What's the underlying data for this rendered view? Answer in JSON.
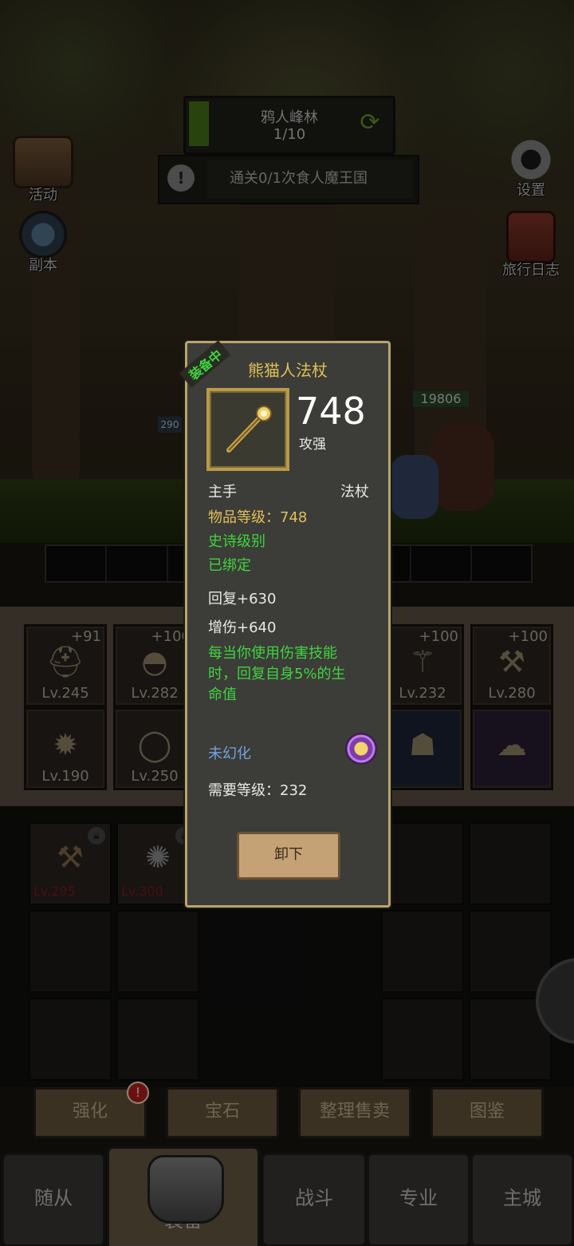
{
  "stage": {
    "title": "鸦人峰林",
    "progress": "1/10",
    "progress_fraction": 0.1
  },
  "quest": {
    "text": "通关0/1次食人魔王国"
  },
  "side": {
    "activity": "活动",
    "dungeon": "副本",
    "settings": "设置",
    "journal": "旅行日志"
  },
  "hero": {
    "health": "19806",
    "small_tag": "290"
  },
  "slots": [
    {
      "plus": "+91",
      "lv": "Lv.245",
      "icon": "helmet-icon"
    },
    {
      "plus": "+100",
      "lv": "Lv.282",
      "icon": "shoulder-icon"
    },
    {
      "plus": "+100",
      "lv": "Lv.232",
      "icon": "staff-icon"
    },
    {
      "plus": "+100",
      "lv": "Lv.280",
      "icon": "mace-icon"
    },
    {
      "lv": "Lv.190",
      "icon": "amulet-icon"
    },
    {
      "lv": "Lv.250",
      "icon": "ring-icon"
    },
    {
      "icon": "pet-icon"
    },
    {
      "icon": "mount-icon"
    }
  ],
  "bag": [
    {
      "lv": "Lv.295",
      "icon": "hammer-icon"
    },
    {
      "lv": "Lv.300",
      "icon": "spiked-ring-icon"
    }
  ],
  "actions": {
    "enhance": "强化",
    "gem": "宝石",
    "sort_sell": "整理售卖",
    "codex": "图鉴",
    "badge": "!"
  },
  "tabs": {
    "followers": "随从",
    "equipment": "装备",
    "battle": "战斗",
    "profession": "专业",
    "main_city": "主城"
  },
  "popup": {
    "ribbon": "装备中",
    "name": "熊猫人法杖",
    "power": "748",
    "power_label": "攻强",
    "slot": "主手",
    "type": "法杖",
    "item_level": "物品等级：748",
    "quality": "史诗级别",
    "bound": "已绑定",
    "stat1": "回复+630",
    "stat2": "增伤+640",
    "effect": "每当你使用伤害技能时，回复自身5%的生命值",
    "illusion": "未幻化",
    "required_level": "需要等级：232",
    "unequip": "卸下"
  },
  "colors": {
    "epic_green": "#3fd43f",
    "gold": "#e0c05a",
    "frame": "#b9a46a"
  }
}
